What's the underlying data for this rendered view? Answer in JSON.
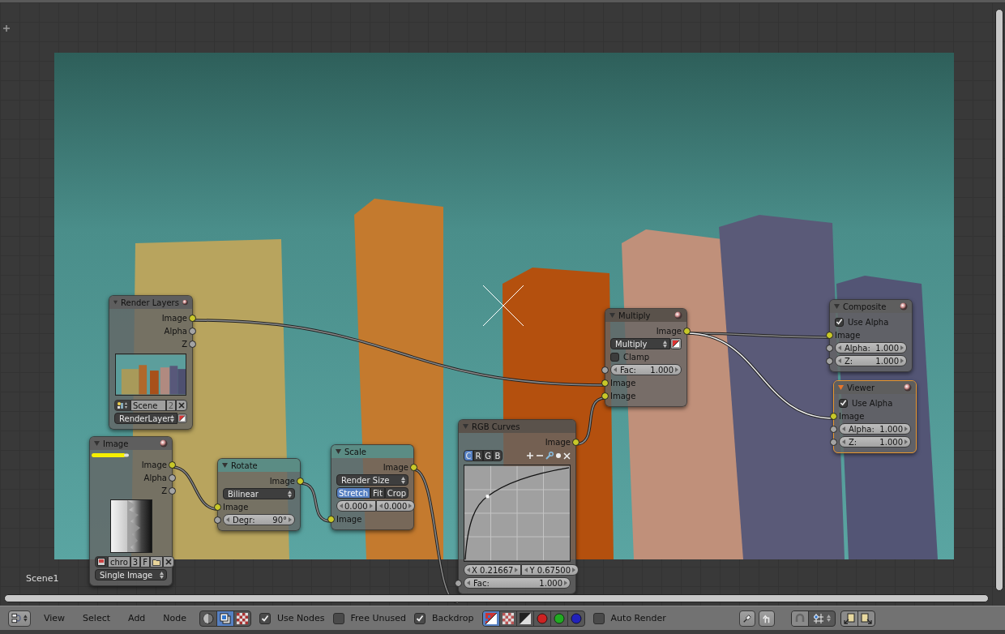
{
  "editor": {
    "overlay_text": "Scene1"
  },
  "nodes": [
    {
      "title": "Render Layers",
      "color": "#5e5e5e",
      "active": false,
      "preview_toggle": true,
      "rows": [
        {
          "kind": "output",
          "label": "Image",
          "color": "#c8c829"
        },
        {
          "kind": "output",
          "label": "Alpha",
          "color": "#a3a3a3"
        },
        {
          "kind": "output",
          "label": "Z",
          "color": "#a3a3a3"
        },
        {
          "kind": "render_preview"
        },
        {
          "kind": "scene_selector",
          "name": "Scene",
          "users": "2"
        },
        {
          "kind": "dropdown_icon",
          "value": "RenderLayer"
        }
      ]
    },
    {
      "title": "Image",
      "color": "#5e5e5e",
      "active": false,
      "preview_toggle": true,
      "rows": [
        {
          "kind": "highlight"
        },
        {
          "kind": "output",
          "label": "Image",
          "color": "#c8c829"
        },
        {
          "kind": "output",
          "label": "Alpha",
          "color": "#a3a3a3"
        },
        {
          "kind": "output",
          "label": "Z",
          "color": "#a3a3a3"
        },
        {
          "kind": "image_preview"
        },
        {
          "kind": "image_selector",
          "name": "chro",
          "users": "3",
          "fake": "F"
        },
        {
          "kind": "dropdown",
          "value": "Single Image"
        }
      ]
    },
    {
      "title": "Rotate",
      "color": "#5b8c84",
      "active": false,
      "preview_toggle": false,
      "rows": [
        {
          "kind": "output",
          "label": "Image",
          "color": "#c8c829"
        },
        {
          "kind": "dropdown",
          "value": "Bilinear"
        },
        {
          "kind": "input",
          "label": "Image",
          "color": "#c8c829"
        },
        {
          "kind": "field",
          "label": "Degr:",
          "value": "90°",
          "color": "#a3a3a3"
        }
      ]
    },
    {
      "title": "Scale",
      "color": "#5b8c84",
      "active": false,
      "preview_toggle": false,
      "rows": [
        {
          "kind": "output",
          "label": "Image",
          "color": "#c8c829"
        },
        {
          "kind": "dropdown",
          "value": "Render Size"
        },
        {
          "kind": "toggles",
          "options": [
            {
              "label": "Stretch",
              "selected": true
            },
            {
              "label": "Fit",
              "selected": false
            },
            {
              "label": "Crop",
              "selected": false
            }
          ]
        },
        {
          "kind": "number_pair",
          "values": [
            "0.000",
            "0.000"
          ]
        },
        {
          "kind": "input",
          "label": "Image",
          "color": "#c8c829"
        }
      ]
    },
    {
      "title": "RGB Curves",
      "color": "#5a524b",
      "active": false,
      "preview_toggle": false,
      "rows": [
        {
          "kind": "output",
          "label": "Image",
          "color": "#c8c829"
        },
        {
          "kind": "curve_tools",
          "options": [
            {
              "label": "C",
              "selected": true
            },
            {
              "label": "R",
              "selected": false
            },
            {
              "label": "G",
              "selected": false
            },
            {
              "label": "B",
              "selected": false
            }
          ]
        },
        {
          "kind": "curve"
        },
        {
          "kind": "number_pair",
          "values": [
            "X 0.21667",
            "Y 0.67500"
          ]
        },
        {
          "kind": "field",
          "label": "Fac:",
          "value": "1.000",
          "color": "#a3a3a3"
        }
      ]
    },
    {
      "title": "Multiply",
      "color": "#5a524b",
      "active": false,
      "preview_toggle": true,
      "rows": [
        {
          "kind": "output",
          "label": "Image",
          "color": "#c8c829"
        },
        {
          "kind": "dropdown_icon",
          "value": "Multiply"
        },
        {
          "kind": "checkbox",
          "label": "Clamp",
          "checked": false
        },
        {
          "kind": "field",
          "label": "Fac:",
          "value": "1.000",
          "color": "#a3a3a3"
        },
        {
          "kind": "input",
          "label": "Image",
          "color": "#c8c829"
        },
        {
          "kind": "input",
          "label": "Image",
          "color": "#c8c829"
        }
      ]
    },
    {
      "title": "Composite",
      "color": "#5e5e5e",
      "active": false,
      "preview_toggle": true,
      "rows": [
        {
          "kind": "checkbox",
          "label": "Use Alpha",
          "checked": true
        },
        {
          "kind": "input",
          "label": "Image",
          "color": "#c8c829"
        },
        {
          "kind": "field",
          "label": "Alpha:",
          "value": "1.000",
          "color": "#a3a3a3"
        },
        {
          "kind": "field",
          "label": "Z:",
          "value": "1.000",
          "color": "#a3a3a3"
        }
      ]
    },
    {
      "title": "Viewer",
      "color": "#5e5e5e",
      "active": true,
      "preview_toggle": true,
      "rows": [
        {
          "kind": "checkbox",
          "label": "Use Alpha",
          "checked": true
        },
        {
          "kind": "input",
          "label": "Image",
          "color": "#c8c829"
        },
        {
          "kind": "field",
          "label": "Alpha:",
          "value": "1.000",
          "color": "#a3a3a3"
        },
        {
          "kind": "field",
          "label": "Z:",
          "value": "1.000",
          "color": "#a3a3a3"
        }
      ]
    }
  ],
  "header": {
    "menus": [
      {
        "label": "View"
      },
      {
        "label": "Select"
      },
      {
        "label": "Add"
      },
      {
        "label": "Node"
      }
    ],
    "tree_types": [
      {
        "kind": "shader",
        "selected": false
      },
      {
        "kind": "compositing",
        "selected": true
      },
      {
        "kind": "texture",
        "selected": false
      }
    ],
    "controls": [
      {
        "kind": "checkbox",
        "label": "Use Nodes",
        "checked": true
      },
      {
        "kind": "checkbox",
        "label": "Free Unused",
        "checked": false
      },
      {
        "kind": "checkbox",
        "label": "Backdrop",
        "checked": true
      },
      {
        "kind": "channels",
        "options": [
          {
            "kind": "color_alpha",
            "selected": true
          },
          {
            "kind": "color",
            "selected": false
          },
          {
            "kind": "alpha",
            "selected": false
          },
          {
            "kind": "red",
            "selected": false
          },
          {
            "kind": "green",
            "selected": false
          },
          {
            "kind": "blue",
            "selected": false
          }
        ]
      },
      {
        "kind": "checkbox",
        "label": "Auto Render",
        "checked": false
      },
      {
        "kind": "pin"
      },
      {
        "kind": "parent"
      },
      {
        "kind": "snap"
      },
      {
        "kind": "copy_paste"
      }
    ]
  }
}
